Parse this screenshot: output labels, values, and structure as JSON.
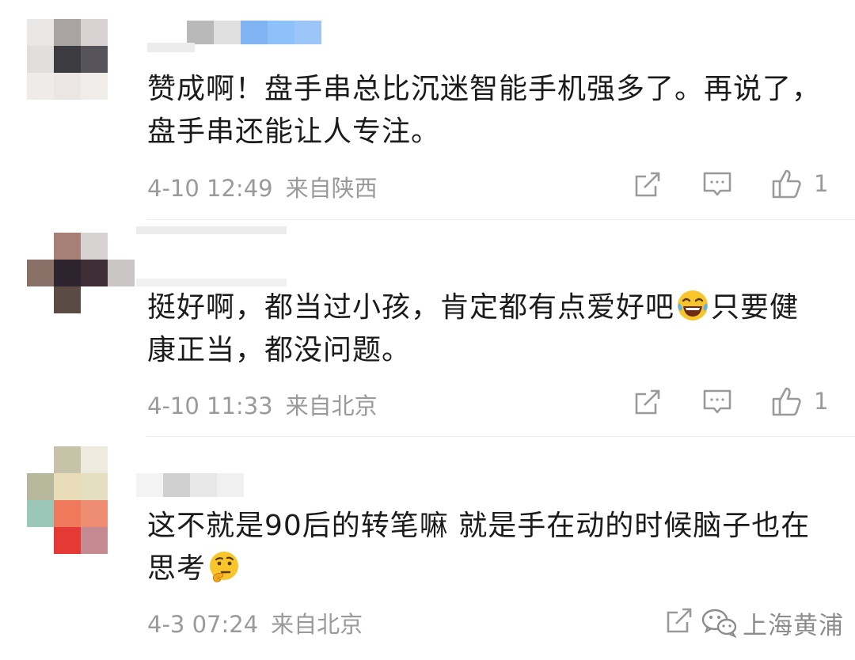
{
  "comments": [
    {
      "text": "赞成啊！盘手串总比沉迷智能手机强多了。再说了，盘手串还能让人专注。",
      "time": "4-10 12:49",
      "location": "来自陕西",
      "likes": "1"
    },
    {
      "text_before": "挺好啊，都当过小孩，肯定都有点爱好吧",
      "emoji": "laughing-tears-emoji",
      "text_after": "只要健康正当，都没问题。",
      "time": "4-10 11:33",
      "location": "来自北京",
      "likes": "1"
    },
    {
      "text_before": "这不就是90后的转笔嘛 就是手在动的时候脑子也在思考",
      "emoji": "thinking-face-emoji",
      "time": "4-3 07:24",
      "location": "来自北京"
    }
  ],
  "icons": [
    "share-icon",
    "reply-icon",
    "like-icon"
  ],
  "watermark": {
    "text": "上海黄浦",
    "icon": "wechat-icon"
  },
  "colors": {
    "text": "#1b1b1b",
    "meta": "#9a9a9a",
    "divider": "#ececec"
  }
}
